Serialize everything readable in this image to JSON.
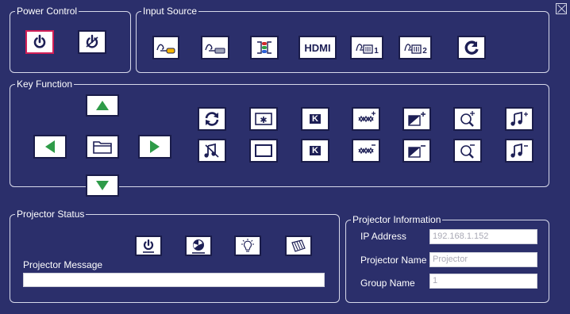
{
  "power_control": {
    "title": "Power Control",
    "buttons": [
      "power-on-icon",
      "power-off-icon"
    ]
  },
  "input_source": {
    "title": "Input Source",
    "buttons": [
      "composite-cable-icon",
      "svideo-cable-icon",
      "component-rgb-icon",
      "hdmi-icon",
      "computer-1-icon",
      "computer-2-icon",
      "auto-source-icon"
    ],
    "hdmi_label": "HDMI",
    "computer1_num": "1",
    "computer2_num": "2"
  },
  "key_function": {
    "title": "Key Function",
    "nav": [
      "up-arrow-icon",
      "left-arrow-icon",
      "menu-folder-icon",
      "right-arrow-icon",
      "down-arrow-icon"
    ],
    "k_label": "K"
  },
  "projector_status": {
    "title": "Projector Status",
    "message_label": "Projector Message",
    "message_value": ""
  },
  "projector_info": {
    "title": "Projector Information",
    "ip_label": "IP Address",
    "ip_value": "192.168.1.152",
    "name_label": "Projector Name",
    "name_value": "Projector",
    "group_label": "Group Name",
    "group_value": "1"
  },
  "colors": {
    "background": "#2b2f6b",
    "selected_border": "#d21f57",
    "arrow_green": "#2e9b48",
    "icon_navy": "#1d1f55"
  }
}
